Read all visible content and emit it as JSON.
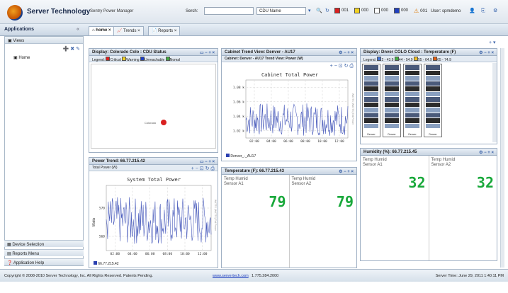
{
  "header": {
    "brand": "Server Technology",
    "product": "Sentry Power Manager",
    "search_label": "Serch:",
    "select_value": "CDU Name",
    "status_counts": [
      "001",
      "000",
      "000",
      "000",
      "001"
    ],
    "user_label": "User: spmdemo"
  },
  "tabs": {
    "applications": "Applications",
    "home": "home",
    "trends": "Trends",
    "reports": "Reports"
  },
  "left": {
    "views_label": "Views",
    "home_item": "Home",
    "nav": [
      "Device Selection",
      "Reports Menu",
      "Application Help"
    ]
  },
  "widgets": {
    "colo": {
      "title": "Display: Colorado Colo : CDU Status",
      "legend_label": "Legend:",
      "legend": [
        {
          "label": "Critical",
          "color": "#d92020"
        },
        {
          "label": "Warning",
          "color": "#f0d020"
        },
        {
          "label": "Unreachable",
          "color": "#2040c0"
        },
        {
          "label": "Nomal",
          "color": "#40a840"
        }
      ],
      "marker_label": "Colorado"
    },
    "cabinet": {
      "title": "Cabinet Trend View: Denver - AU17",
      "subtitle": "Cabinet: Denver - AU17 Trend View: Power (W)",
      "chart_title": "Cabinet Total Power",
      "side_label": "WATTS (WATTS) Totl Power",
      "legend": "Denver_-_AU17"
    },
    "dcloud": {
      "title": "Display: Dnver COLO Cloud : Temperature (F)",
      "legend_label": "Legend:",
      "legend": [
        {
          "label": "2 - 43.9",
          "color": "#4878d8"
        },
        {
          "label": "44 - 54.9",
          "color": "#40b040"
        },
        {
          "label": "55 - 64.9",
          "color": "#f0c020"
        },
        {
          "label": "65 - 74.9",
          "color": "#e86010"
        }
      ],
      "rack_label": "Denver"
    },
    "powertrend": {
      "title": "Power Trend: 66.77.215.42",
      "subtitle": "Total Power (W)",
      "chart_title": "System Total Power",
      "ylabel": "Watts",
      "side_label": "WATTS (WATTS) Totl Power",
      "legend": "66.77.215.42"
    },
    "temp": {
      "title": "Temperature (F): 66.77.215.43",
      "sensors": [
        {
          "label": "Temp Humid\nSensor A1",
          "value": "79"
        },
        {
          "label": "Temp Humid\nSensor A2",
          "value": "79"
        }
      ]
    },
    "humidity": {
      "title": "Humidity (%): 66.77.215.45",
      "sensors": [
        {
          "label": "Temp Humid\nSensor A1",
          "value": "32"
        },
        {
          "label": "Temp Humid\nSensor A2",
          "value": "32"
        }
      ]
    }
  },
  "chart_data": [
    {
      "type": "line",
      "title": "Cabinet Total Power",
      "x": [
        "02:00",
        "04:00",
        "06:00",
        "08:00",
        "10:00",
        "12:00"
      ],
      "yticks": [
        "1.02 k",
        "1.04 k",
        "1.06 k",
        "1.08 k"
      ],
      "ylim": [
        1010,
        1090
      ],
      "series": [
        {
          "name": "Denver_-_AU17",
          "color": "#2a3fb0"
        }
      ]
    },
    {
      "type": "line",
      "title": "System Total Power",
      "ylabel": "Watts",
      "x": [
        "02:00",
        "04:00",
        "06:00",
        "08:00",
        "10:00",
        "12:00"
      ],
      "yticks": [
        "560",
        "570"
      ],
      "ylim": [
        555,
        578
      ],
      "series": [
        {
          "name": "66.77.215.42",
          "color": "#2a3fb0"
        }
      ]
    }
  ],
  "footer": {
    "copyright": "Copyright © 2008-2010 Server Technology, Inc. All Rights Reserved. Patents Pending.",
    "link": "www.servertech.com",
    "phone": "1.775.284.2000",
    "server_time": "Server Time: June 29, 2011 1:40:11 PM"
  }
}
